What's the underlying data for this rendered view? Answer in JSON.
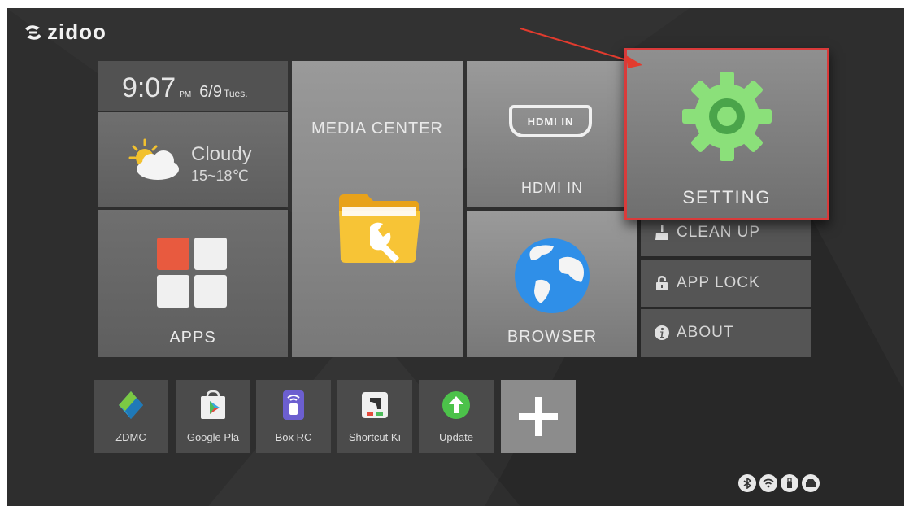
{
  "brand": {
    "logo_text": "zidoo"
  },
  "clock": {
    "time": "9:07",
    "ampm": "PM",
    "date": "6/9",
    "weekday": "Tues."
  },
  "weather": {
    "condition": "Cloudy",
    "temperature": "15~18℃",
    "icon": "cloud-sun-icon"
  },
  "tiles": {
    "media_center": "MEDIA CENTER",
    "hdmi_in": "HDMI IN",
    "hdmi_badge": "HDMI IN",
    "setting": "SETTING",
    "apps": "APPS",
    "browser": "BROWSER"
  },
  "side_menu": [
    {
      "label": "CLEAN UP",
      "icon": "broom-icon"
    },
    {
      "label": "APP LOCK",
      "icon": "lock-icon"
    },
    {
      "label": "ABOUT",
      "icon": "info-icon"
    }
  ],
  "shortcuts": [
    {
      "label": "ZDMC",
      "icon": "zdmc-icon"
    },
    {
      "label": "Google Pla",
      "icon": "google-play-icon"
    },
    {
      "label": "Box RC",
      "icon": "remote-icon"
    },
    {
      "label": "Shortcut Kı",
      "icon": "shortcut-key-icon"
    },
    {
      "label": "Update",
      "icon": "update-icon"
    }
  ],
  "add_shortcut": {
    "icon": "plus-icon"
  },
  "status_bar": [
    "bluetooth-icon",
    "wifi-icon",
    "usb-icon",
    "storage-icon"
  ],
  "colors": {
    "background": "#2e2e2e",
    "highlight_border": "#d93a3a",
    "annotation_arrow": "#e23b2e",
    "setting_gear": "#8be07a",
    "apps_red": "#e85a3f"
  }
}
